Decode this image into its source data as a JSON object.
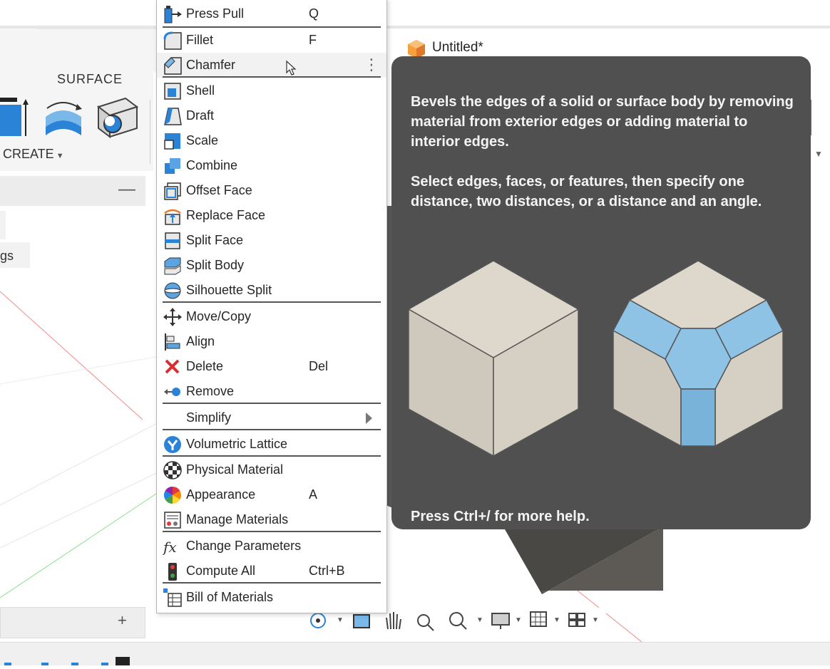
{
  "app": {
    "ribbon_section": "SURFACE",
    "create_label": "CREATE",
    "browser_partial_text": "gs",
    "document_title": "Untitled*"
  },
  "menu": {
    "items": [
      {
        "label": "Press Pull",
        "shortcut": "Q",
        "icon": "press-pull-icon"
      },
      {
        "label": "Fillet",
        "shortcut": "F",
        "icon": "fillet-icon"
      },
      {
        "label": "Chamfer",
        "shortcut": "",
        "icon": "chamfer-icon",
        "highlighted": true
      },
      {
        "label": "Shell",
        "shortcut": "",
        "icon": "shell-icon"
      },
      {
        "label": "Draft",
        "shortcut": "",
        "icon": "draft-icon"
      },
      {
        "label": "Scale",
        "shortcut": "",
        "icon": "scale-icon"
      },
      {
        "label": "Combine",
        "shortcut": "",
        "icon": "combine-icon"
      },
      {
        "label": "Offset Face",
        "shortcut": "",
        "icon": "offset-face-icon"
      },
      {
        "label": "Replace Face",
        "shortcut": "",
        "icon": "replace-face-icon"
      },
      {
        "label": "Split Face",
        "shortcut": "",
        "icon": "split-face-icon"
      },
      {
        "label": "Split Body",
        "shortcut": "",
        "icon": "split-body-icon"
      },
      {
        "label": "Silhouette Split",
        "shortcut": "",
        "icon": "silhouette-split-icon"
      },
      {
        "label": "Move/Copy",
        "shortcut": "",
        "icon": "move-copy-icon"
      },
      {
        "label": "Align",
        "shortcut": "",
        "icon": "align-icon"
      },
      {
        "label": "Delete",
        "shortcut": "Del",
        "icon": "delete-icon"
      },
      {
        "label": "Remove",
        "shortcut": "",
        "icon": "remove-icon"
      },
      {
        "label": "Simplify",
        "shortcut": "",
        "icon": "submenu-arrow-icon"
      },
      {
        "label": "Volumetric Lattice",
        "shortcut": "",
        "icon": "volumetric-lattice-icon"
      },
      {
        "label": "Physical Material",
        "shortcut": "",
        "icon": "physical-material-icon"
      },
      {
        "label": "Appearance",
        "shortcut": "A",
        "icon": "appearance-icon"
      },
      {
        "label": "Manage Materials",
        "shortcut": "",
        "icon": "manage-materials-icon"
      },
      {
        "label": "Change Parameters",
        "shortcut": "",
        "icon": "fx-icon"
      },
      {
        "label": "Compute All",
        "shortcut": "Ctrl+B",
        "icon": "compute-all-icon"
      },
      {
        "label": "Bill of Materials",
        "shortcut": "",
        "icon": "bill-of-materials-icon"
      }
    ]
  },
  "tooltip": {
    "description": "Bevels the edges of a solid or surface body by removing material from exterior edges or adding material to interior edges.",
    "instructions": "Select edges, faces, or features, then specify one distance, two distances, or a distance and an angle.",
    "help": "Press Ctrl+/ for more help."
  },
  "colors": {
    "tooltip_bg": "#505050",
    "accent_blue": "#4a90d9",
    "chamfer_face": "#8ec3e6",
    "cube_face": "#d8d2c6"
  }
}
